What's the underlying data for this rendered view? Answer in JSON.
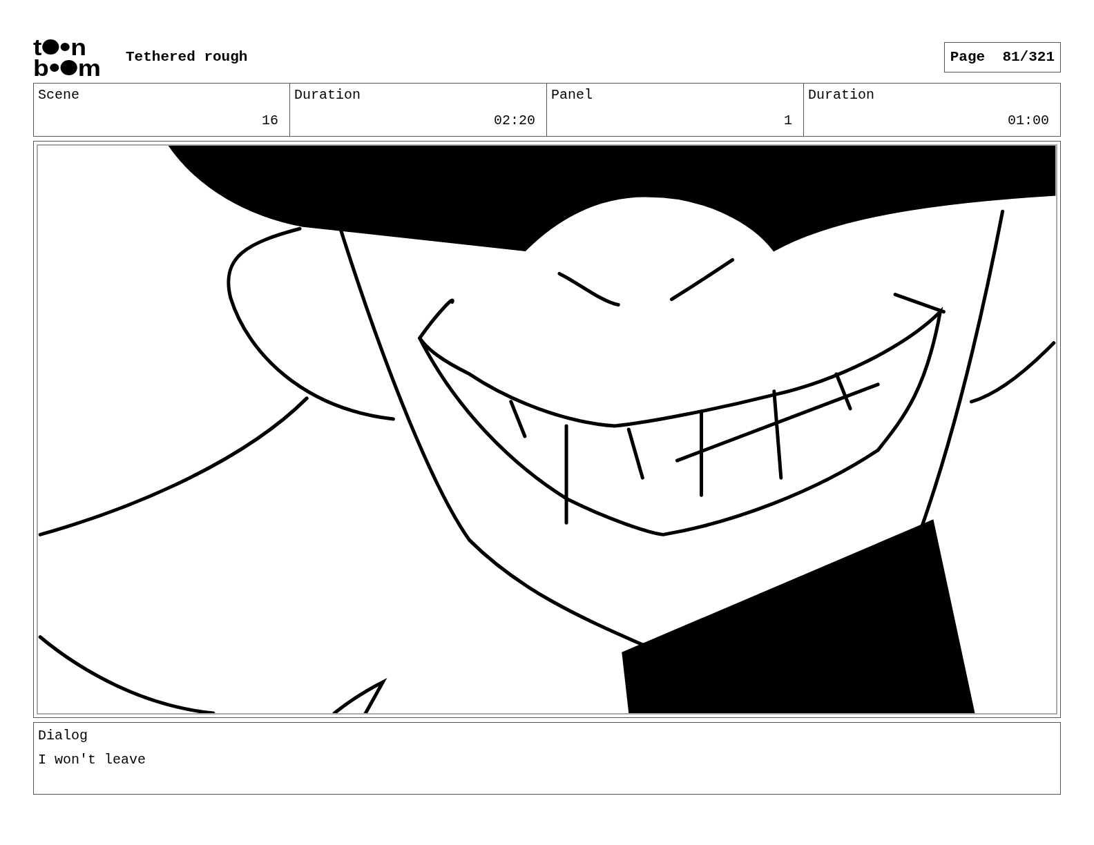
{
  "logo": {
    "top": [
      "t",
      "n"
    ],
    "bottom": [
      "b",
      "m"
    ]
  },
  "title": "Tethered rough",
  "page": {
    "label": "Page",
    "value": "81/321"
  },
  "fields": [
    {
      "label": "Scene",
      "value": "16"
    },
    {
      "label": "Duration",
      "value": "02:20"
    },
    {
      "label": "Panel",
      "value": "1"
    },
    {
      "label": "Duration",
      "value": "01:00"
    }
  ],
  "dialog": {
    "label": "Dialog",
    "text": "I won't leave"
  }
}
